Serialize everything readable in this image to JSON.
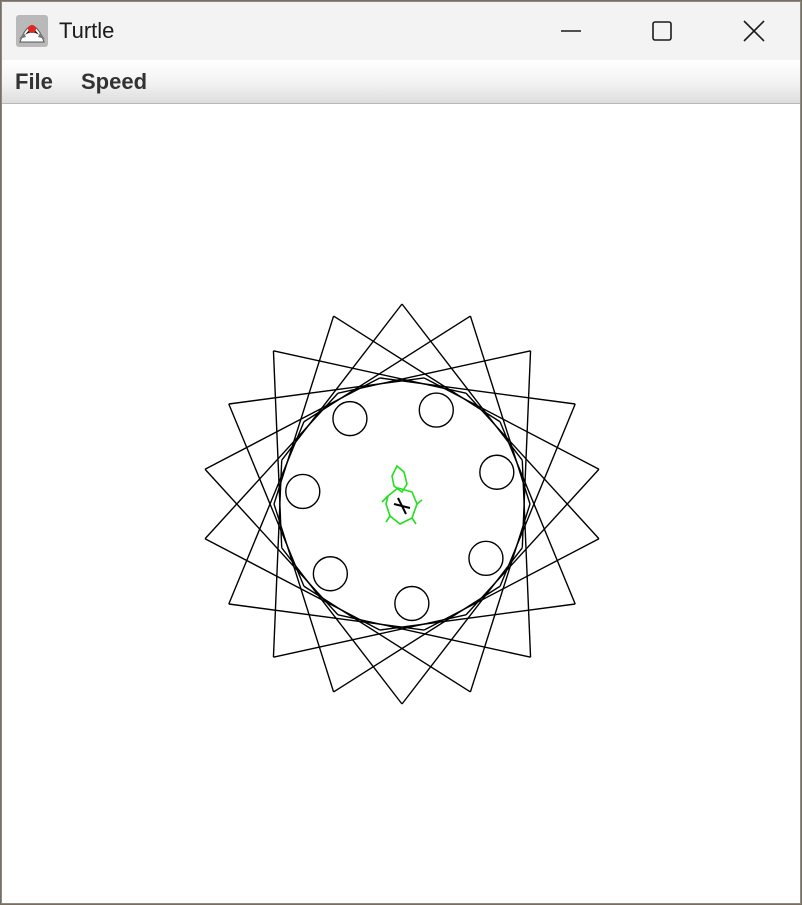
{
  "window": {
    "title": "Turtle",
    "icon": "java-duke-icon"
  },
  "title_buttons": [
    {
      "name": "minimize-button",
      "icon": "minimize-icon"
    },
    {
      "name": "maximize-button",
      "icon": "maximize-icon"
    },
    {
      "name": "close-button",
      "icon": "close-icon"
    }
  ],
  "menu": {
    "file_label": "File",
    "speed_label": "Speed"
  },
  "drawing": {
    "line_color": "#000000",
    "turtle_color": "#22e01e",
    "background": "#ffffff"
  }
}
